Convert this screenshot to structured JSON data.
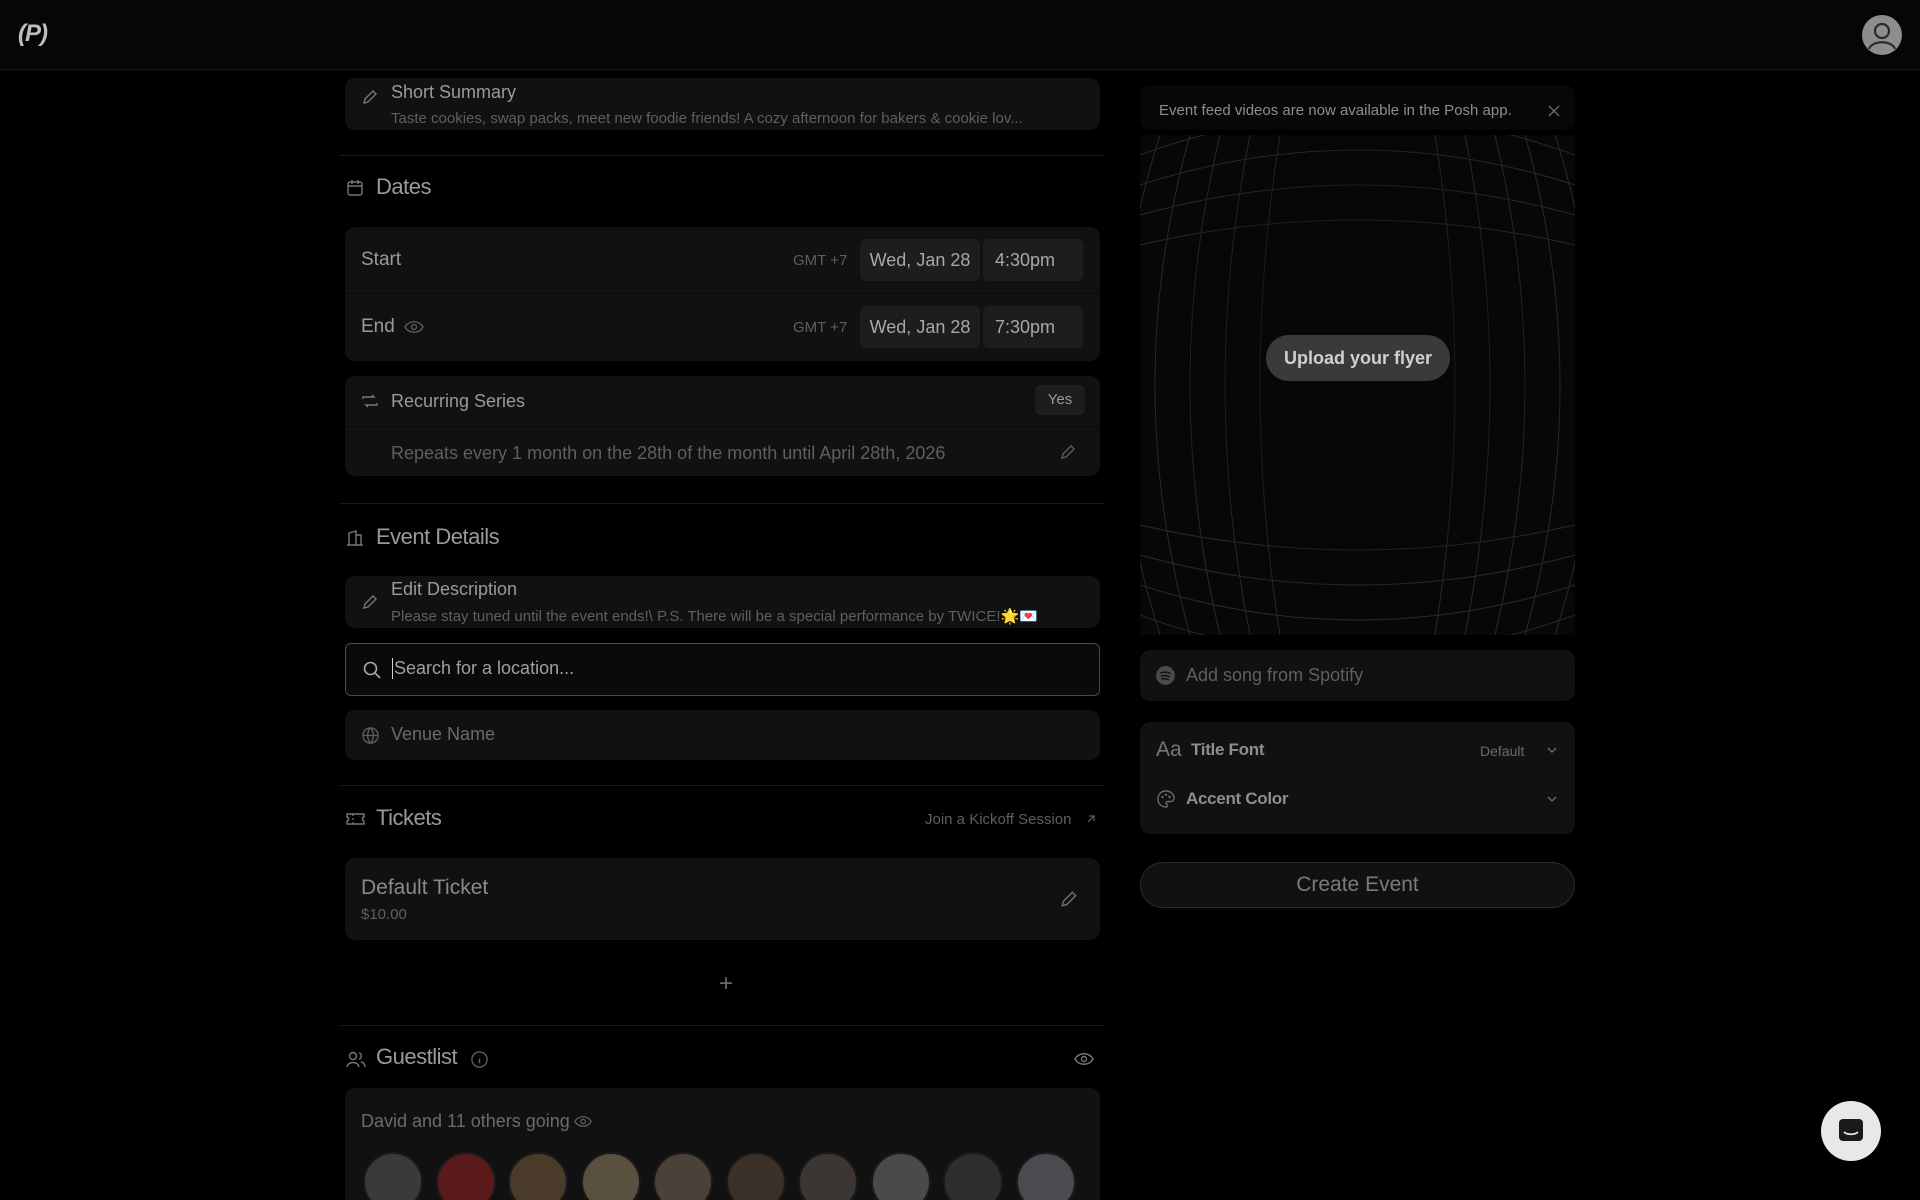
{
  "header": {
    "logo": "(P)",
    "avatar_icon": "user-icon"
  },
  "summary": {
    "label": "Short Summary",
    "text": "Taste cookies, swap packs, meet new foodie friends! A cozy afternoon for bakers & cookie lov..."
  },
  "dates": {
    "title": "Dates",
    "start": {
      "label": "Start",
      "tz": "GMT +7",
      "date": "Wed, Jan 28",
      "time": "4:30pm"
    },
    "end": {
      "label": "End",
      "tz": "GMT +7",
      "date": "Wed, Jan 28",
      "time": "7:30pm"
    },
    "recurring": {
      "label": "Recurring Series",
      "value": "Yes",
      "description": "Repeats every 1 month on the 28th of the month until April 28th, 2026"
    }
  },
  "event_details": {
    "title": "Event Details",
    "description_label": "Edit Description",
    "description_text": "Please stay tuned until the event ends!\\ P.S. There will be a special performance by TWICE!🌟💌",
    "location_placeholder": "Search for a location...",
    "venue_placeholder": "Venue Name"
  },
  "tickets": {
    "title": "Tickets",
    "kickoff_link": "Join a Kickoff Session",
    "items": [
      {
        "name": "Default Ticket",
        "price": "$10.00"
      }
    ],
    "add_symbol": "+"
  },
  "guestlist": {
    "title": "Guestlist",
    "going_text": "David and 11 others going",
    "avatars": [
      "a1",
      "a2",
      "a3",
      "a4",
      "a5",
      "a6",
      "a7",
      "a8",
      "a9",
      "a10"
    ]
  },
  "right": {
    "notice": "Event feed videos are now available in the Posh app.",
    "upload_label": "Upload your flyer",
    "spotify_placeholder": "Add song from Spotify",
    "title_font": {
      "icon_text": "Aa",
      "label": "Title Font",
      "value": "Default"
    },
    "accent_color": {
      "label": "Accent Color"
    },
    "create_button": "Create Event"
  },
  "colors": {
    "background": "#000000",
    "card": "#111111",
    "input_border": "#4a4a4a"
  }
}
